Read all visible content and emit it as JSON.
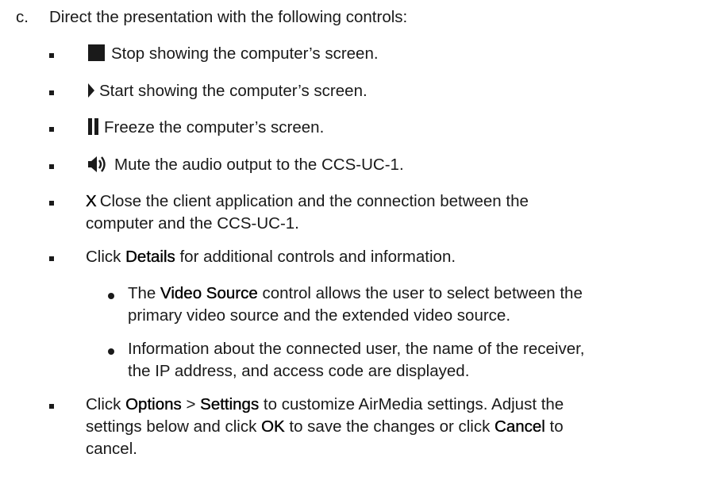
{
  "step": {
    "marker": "c.",
    "text": "Direct the presentation with the following controls:"
  },
  "controls": [
    {
      "icon": "stop-icon",
      "text": "Stop showing the computer’s screen."
    },
    {
      "icon": "play-icon",
      "text": "Start showing the computer’s screen."
    },
    {
      "icon": "pause-icon",
      "text": "Freeze the computer’s screen."
    },
    {
      "icon": "speaker-icon",
      "text": "Mute the audio output to the CCS-UC-1."
    },
    {
      "icon": "x-mark",
      "mark": "X",
      "line1": "Close the client application and the connection between the",
      "line2": "computer and the CCS-UC-1."
    }
  ],
  "details_item": {
    "before": "Click ",
    "term": "Details",
    "after": " for additional controls and information."
  },
  "details_sub": [
    {
      "line1_before": "The ",
      "line1_term": "Video Source",
      "line1_after": " control allows the user to select between the",
      "line2": "primary video source and the extended video source."
    },
    {
      "line1": "Information about the connected user, the name of the receiver,",
      "line2": "the IP address, and access code are displayed."
    }
  ],
  "options_item": {
    "l1_before": "Click ",
    "l1_term1": "Options",
    "l1_sep": " > ",
    "l1_term2": "Settings",
    "l1_after": " to customize AirMedia settings. Adjust the",
    "l2_before": "settings below and click ",
    "l2_term1": "OK",
    "l2_mid": " to save the changes or click ",
    "l2_term2": "Cancel",
    "l2_after": " to",
    "l3": "cancel."
  }
}
